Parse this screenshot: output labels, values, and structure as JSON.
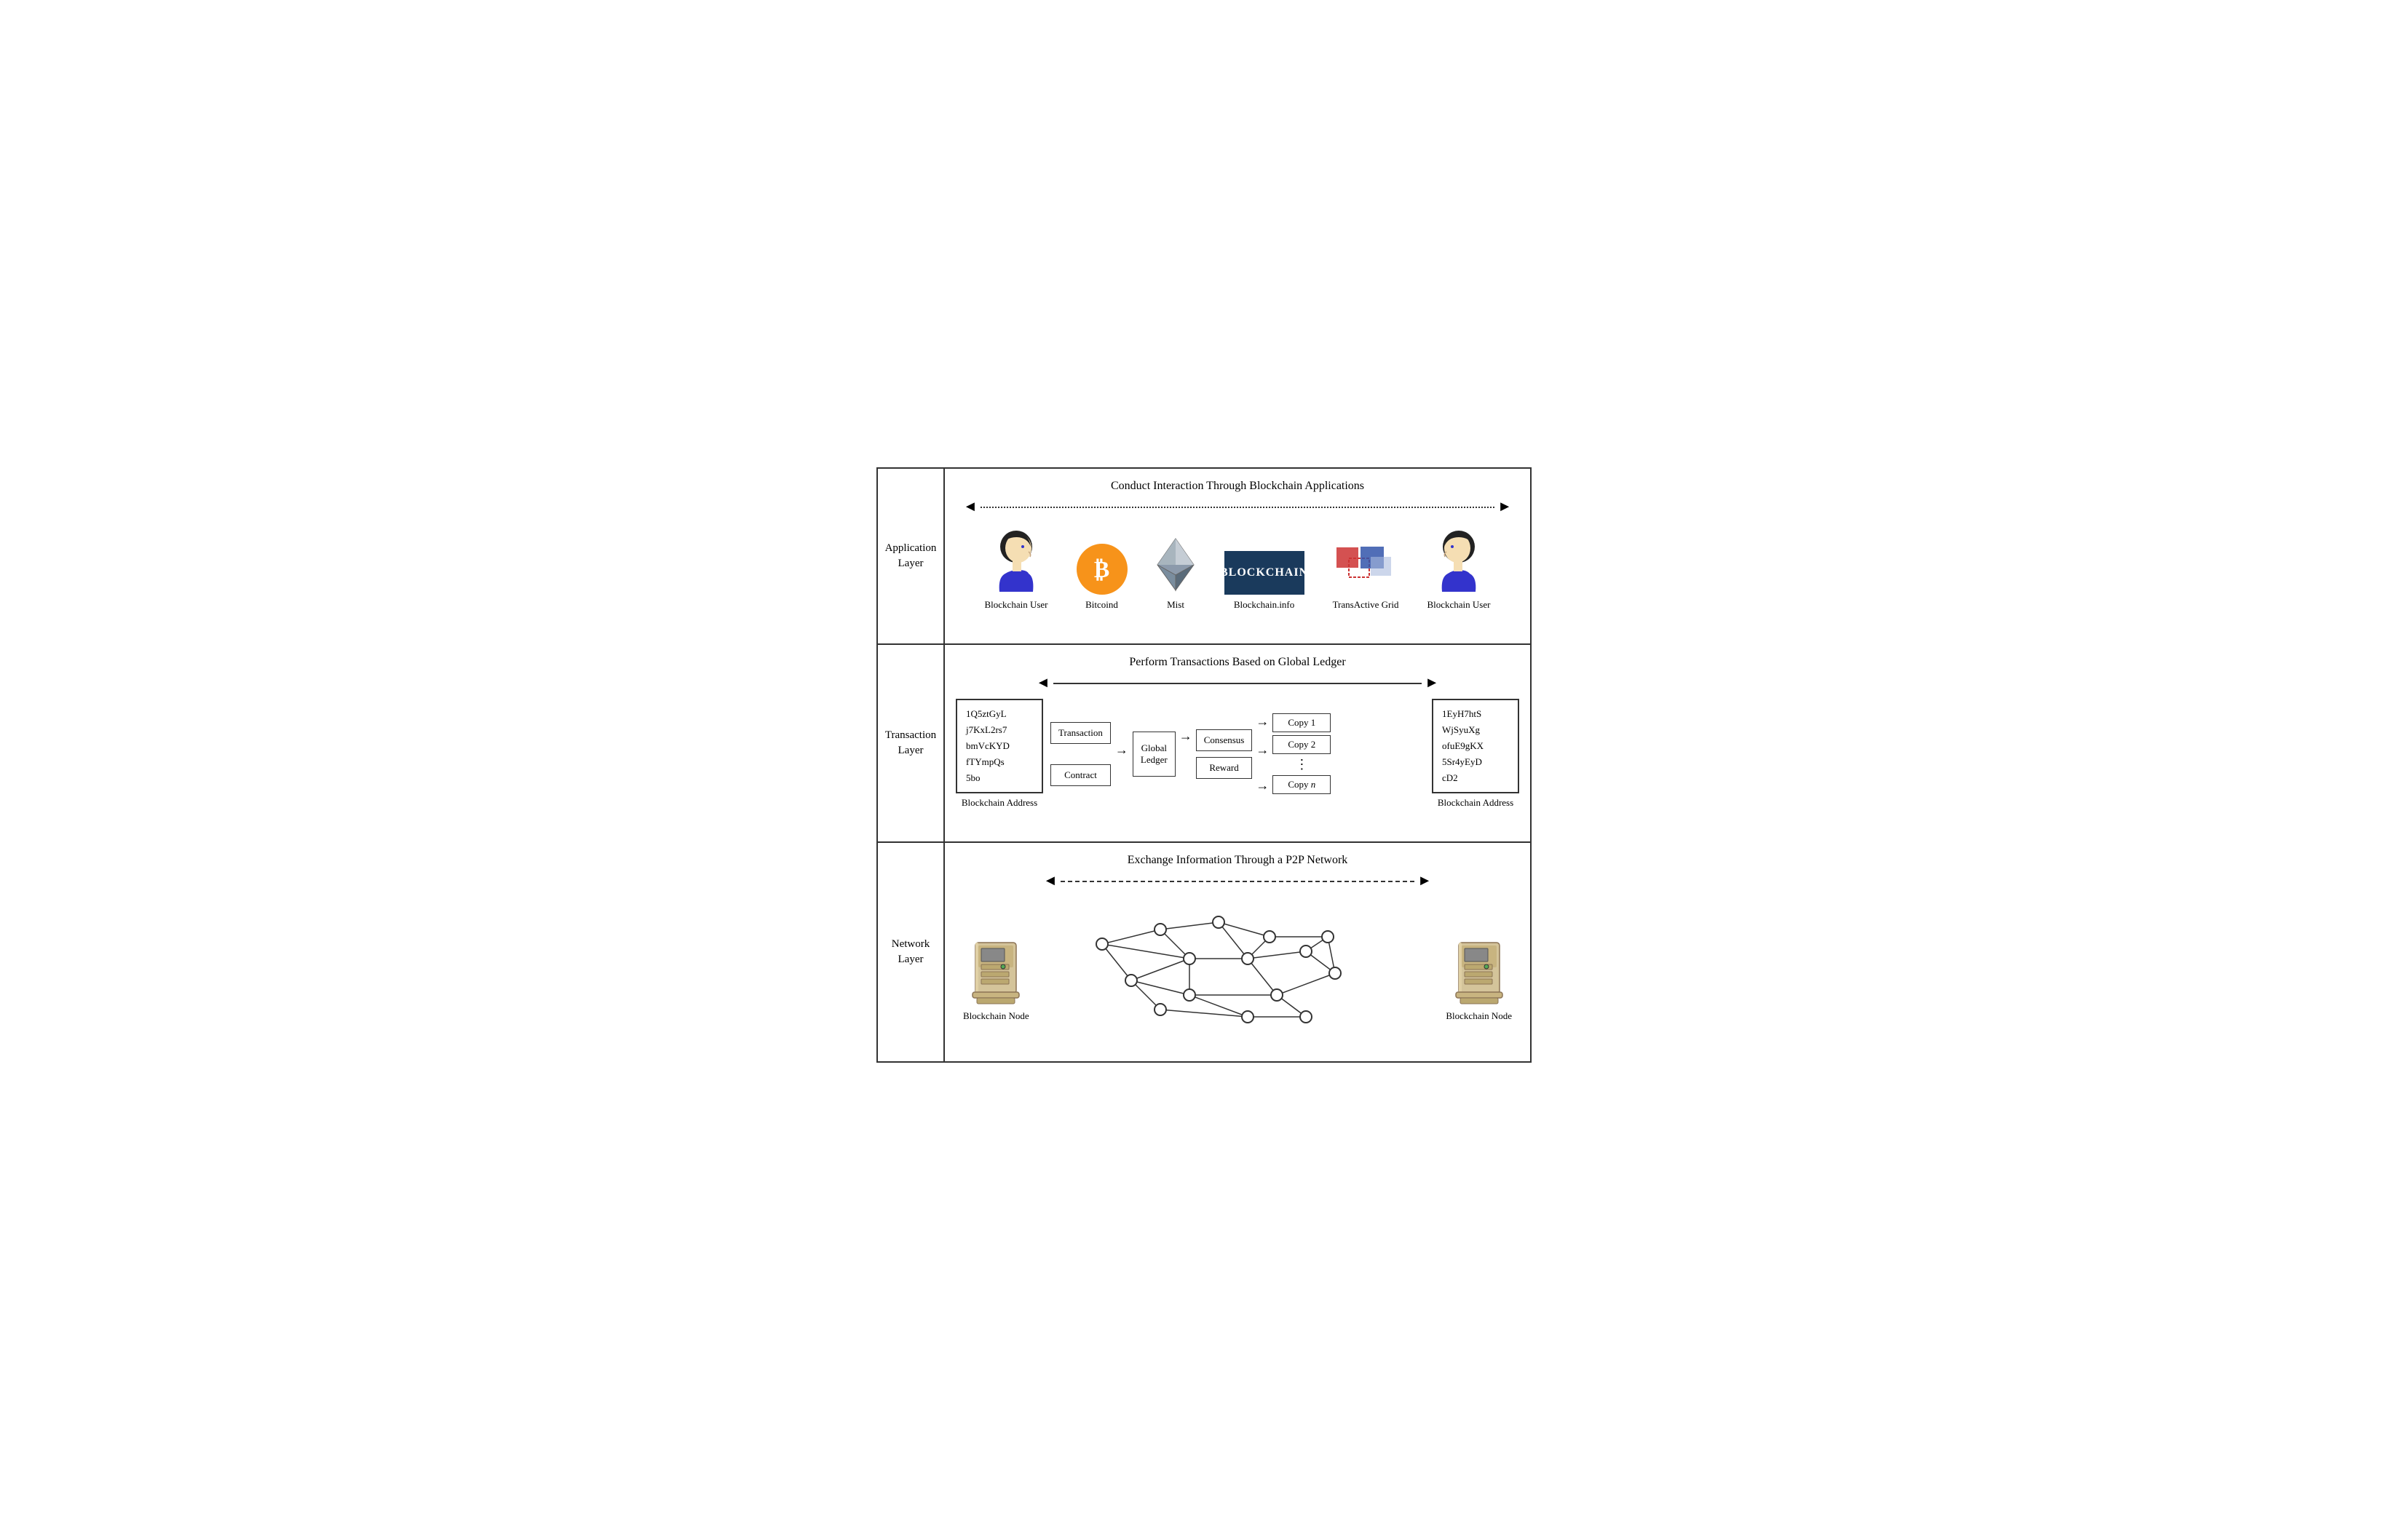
{
  "layers": {
    "application": {
      "label": "Application\nLayer",
      "title": "Conduct Interaction Through Blockchain Applications",
      "users": {
        "left": "Blockchain User",
        "right": "Blockchain User"
      },
      "apps": [
        {
          "name": "Bitcoind",
          "type": "bitcoin"
        },
        {
          "name": "Mist",
          "type": "ethereum"
        },
        {
          "name": "Blockchain.info",
          "type": "blockchain-info"
        },
        {
          "name": "TransActive Grid",
          "type": "transactive"
        }
      ]
    },
    "transaction": {
      "label": "Transaction\nLayer",
      "title": "Perform Transactions Based on Global Ledger",
      "leftAddress": {
        "lines": [
          "1Q5ztGyL",
          "j7KxL2rs7",
          "bmVcKYD",
          "fTYmpQs",
          "5bo"
        ],
        "label": "Blockchain Address"
      },
      "rightAddress": {
        "lines": [
          "1EyH7htS",
          "WjSyuXg",
          "ofuE9gKX",
          "5Sr4yEyD",
          "cD2"
        ],
        "label": "Blockchain Address"
      },
      "flow": {
        "inputs": [
          "Transaction",
          "Contract"
        ],
        "middle": "Global\nLedger",
        "consensus": [
          "Consensus",
          "Reward"
        ],
        "copies": [
          "Copy 1",
          "Copy 2",
          "⋮",
          "Copy n"
        ]
      }
    },
    "network": {
      "label": "Network\nLayer",
      "title": "Exchange Information Through a P2P Network",
      "leftNode": "Blockchain Node",
      "rightNode": "Blockchain Node"
    }
  }
}
